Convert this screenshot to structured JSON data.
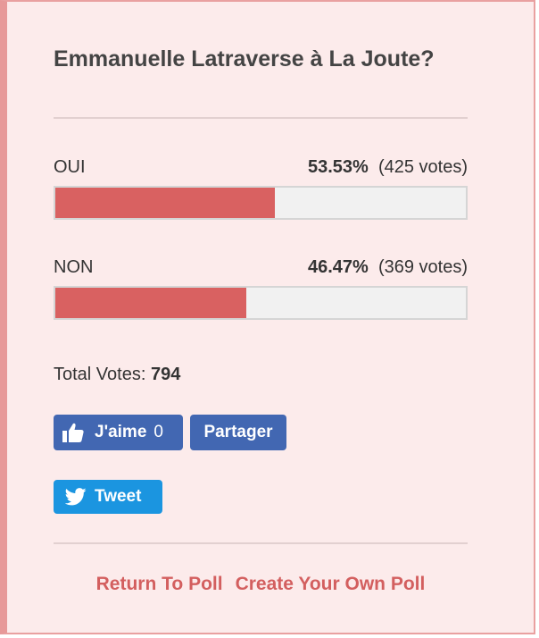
{
  "poll": {
    "question": "Emmanuelle Latraverse à La Joute?",
    "options": [
      {
        "label": "OUI",
        "percent": "53.53%",
        "votes": "(425 votes)",
        "fill": 0.5353
      },
      {
        "label": "NON",
        "percent": "46.47%",
        "votes": "(369 votes)",
        "fill": 0.4647
      }
    ],
    "total_label": "Total Votes:",
    "total_value": "794"
  },
  "social": {
    "like_label": "J'aime",
    "like_count": "0",
    "share_label": "Partager",
    "tweet_label": "Tweet"
  },
  "links": {
    "return": "Return To Poll",
    "create": "Create Your Own Poll"
  },
  "colors": {
    "card_bg": "#fcebeb",
    "card_border": "#e9a0a0",
    "bar_fill": "#d96161",
    "bar_track": "#f1f1f1",
    "facebook": "#4267b2",
    "twitter": "#1b95e0",
    "link": "#d35f5f"
  },
  "icons": {
    "like": "thumbs-up-icon",
    "tweet": "twitter-bird-icon"
  }
}
